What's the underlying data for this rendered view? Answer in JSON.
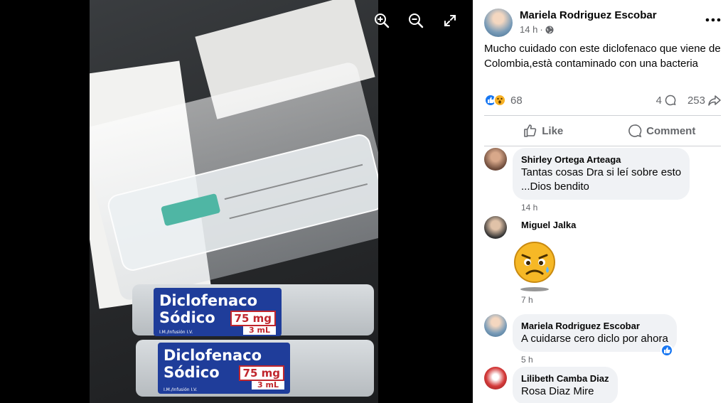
{
  "viewer": {
    "photo": {
      "ampoule_labels": [
        {
          "line1": "Diclofenaco",
          "line2": "Sódico",
          "dose": "75 mg",
          "volume": "3 mL",
          "route": "I.M./Infusión I.V."
        },
        {
          "line1": "Diclofenaco",
          "line2": "Sódico",
          "dose": "75 mg",
          "volume": "3 mL",
          "route": "I.M./Infusión I.V."
        }
      ]
    },
    "controls": {
      "zoom_in_icon": "zoom-in-icon",
      "zoom_out_icon": "zoom-out-icon",
      "fullscreen_icon": "expand-icon"
    }
  },
  "post": {
    "author": "Mariela Rodriguez Escobar",
    "time": "14 h",
    "privacy_icon": "globe-icon",
    "text": "Mucho cuidado con este diclofenaco que viene de Colombia,està contaminado con una bacteria",
    "reaction_count": "68",
    "comment_count": "4",
    "share_count": "253",
    "actions": {
      "like": "Like",
      "comment": "Comment"
    }
  },
  "comments": [
    {
      "name": "Shirley Ortega Arteaga",
      "text_line1": "Tantas cosas Dra si leí sobre esto",
      "text_line2": "...Dios bendito",
      "time": "14 h"
    },
    {
      "name": "Miguel Jalka",
      "sticker": "worried-emoji-sticker",
      "time": "7 h"
    },
    {
      "name": "Mariela Rodriguez Escobar",
      "text": "A cuidarse cero diclo por ahora",
      "time": "5 h"
    },
    {
      "name": "Lilibeth Camba Diaz",
      "text": "Rosa Diaz Mire"
    }
  ],
  "colors": {
    "accent": "#1877f2",
    "muted": "#65676b",
    "bubble": "#f0f2f5",
    "label_blue": "#1f3d9a",
    "label_red": "#c0262d"
  }
}
